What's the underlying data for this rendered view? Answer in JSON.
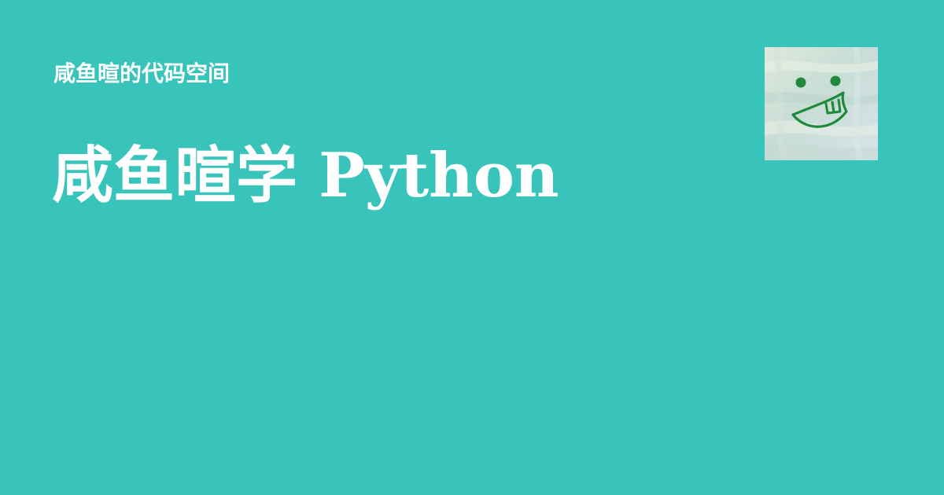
{
  "site": {
    "name": "咸鱼暄的代码空间"
  },
  "page": {
    "title": "咸鱼暄学 Python"
  },
  "colors": {
    "background": "#39c4bb",
    "text": "#ffffff",
    "avatar_face": "#1f8a3a",
    "avatar_bg": "#cfe2d8"
  },
  "avatar": {
    "icon": "smiley-face-icon"
  }
}
